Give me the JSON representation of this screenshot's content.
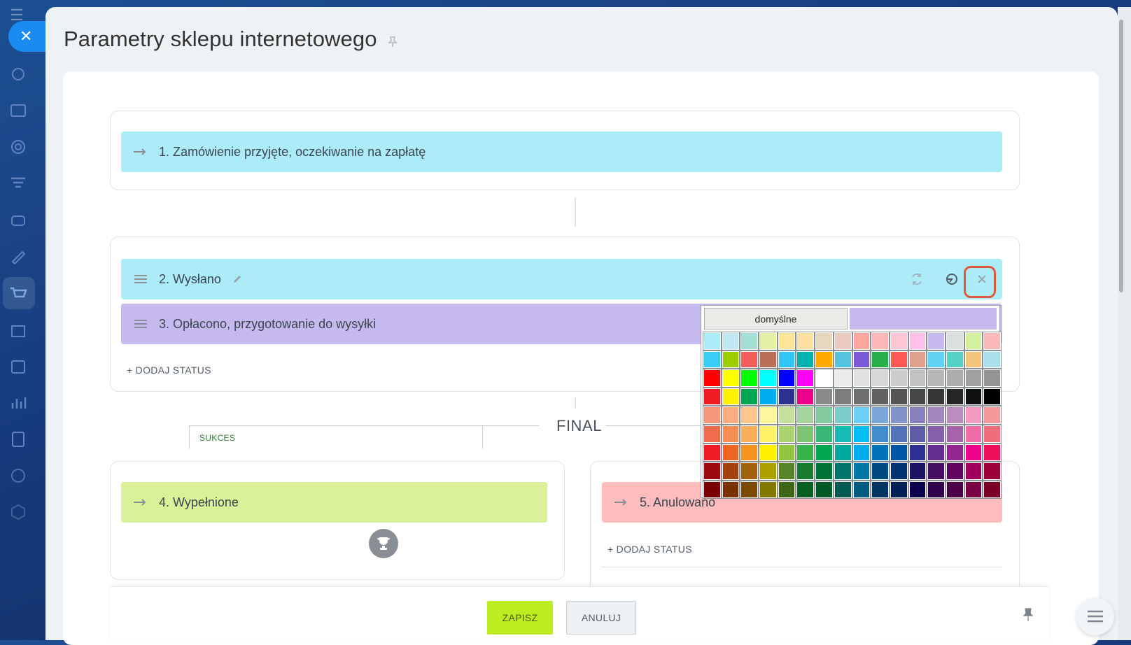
{
  "header": {
    "title": "Parametry sklepu internetowego",
    "pin_icon": "pin-icon"
  },
  "sidebar": {
    "items": [
      {
        "icon": "crm-icon"
      },
      {
        "icon": "contacts-icon"
      },
      {
        "icon": "target-icon"
      },
      {
        "icon": "funnel-icon"
      },
      {
        "icon": "robot-icon"
      },
      {
        "icon": "sign-icon"
      },
      {
        "icon": "cart-icon",
        "active": true
      },
      {
        "icon": "store-icon"
      },
      {
        "icon": "calendar-icon"
      },
      {
        "icon": "analytics-icon"
      },
      {
        "icon": "document-icon"
      },
      {
        "icon": "circle-icon"
      },
      {
        "icon": "box-icon"
      }
    ]
  },
  "statuses": {
    "s1": {
      "label": "1. Zamówienie przyjęte, oczekiwanie na zapłatę",
      "color": "#acebf8"
    },
    "s2": {
      "label": "2. Wysłano",
      "color": "#acebf8"
    },
    "s3": {
      "label": "3. Opłacono, przygotowanie do wysyłki",
      "color": "#c6b9ee"
    },
    "s4": {
      "label": "4. Wypełnione",
      "color": "#dbf199"
    },
    "s5": {
      "label": "5. Anulowano",
      "color": "#ffbebd"
    }
  },
  "add_status_label": "+ DODAJ STATUS",
  "final": {
    "label": "FINAL",
    "success_tab": "SUKCES"
  },
  "footer": {
    "save_label": "ZAPISZ",
    "cancel_label": "ANULUJ"
  },
  "picker": {
    "default_label": "domyślne",
    "colors": [
      "#acebf8",
      "#bfe8f2",
      "#a6dfd8",
      "#e4f0a4",
      "#fde598",
      "#fde1a0",
      "#e9d7bd",
      "#e9c9c0",
      "#fda69e",
      "#fbb8b6",
      "#ffc6d5",
      "#ffc0e8",
      "#c6b9ee",
      "#dcdfe0",
      "#d5f09c",
      "#fbb8b8",
      "#39cdf6",
      "#9dcf00",
      "#f45e5a",
      "#b96e56",
      "#2fc6f6",
      "#00b4ae",
      "#ffa900",
      "#55c3df",
      "#7b59d6",
      "#28b04a",
      "#ff5752",
      "#e0a08e",
      "#61d4f5",
      "#56d2c4",
      "#f4c47c",
      "#a9e0ec",
      "#ff0000",
      "#ffff00",
      "#00ff00",
      "#00ffff",
      "#0000ff",
      "#ff00ff",
      "#ffffff",
      "#ebebeb",
      "#e1e1e1",
      "#d7d7d7",
      "#cccccc",
      "#c2c2c2",
      "#b7b7b7",
      "#acacac",
      "#a0a0a0",
      "#959595",
      "#ee1d24",
      "#fff100",
      "#00a650",
      "#00aeef",
      "#2f3192",
      "#ed008c",
      "#898989",
      "#7d7d7d",
      "#707070",
      "#626262",
      "#555555",
      "#464646",
      "#363636",
      "#262626",
      "#111111",
      "#000000",
      "#f7977a",
      "#fbad82",
      "#fdc68c",
      "#fff799",
      "#c6df9c",
      "#a4d49d",
      "#81ca9d",
      "#7bcdc9",
      "#6ccff7",
      "#7ca6d8",
      "#8293ca",
      "#8881be",
      "#a286bd",
      "#bc8cbf",
      "#f49bc1",
      "#f5999d",
      "#f16c4d",
      "#f68e54",
      "#fbaf5a",
      "#fff467",
      "#acd372",
      "#7dc473",
      "#39b778",
      "#16bcb4",
      "#00bff3",
      "#438ccb",
      "#5573b7",
      "#5e5ca7",
      "#855fa8",
      "#a763a9",
      "#ef6ea8",
      "#f16d7e",
      "#ee1d24",
      "#f16522",
      "#f7941d",
      "#fff100",
      "#8fc63d",
      "#37b44a",
      "#00a650",
      "#00a99e",
      "#00aeef",
      "#0072bc",
      "#0054a5",
      "#2f3192",
      "#652c91",
      "#91278f",
      "#ed008c",
      "#ee105a",
      "#9d0a0f",
      "#a1410d",
      "#a36209",
      "#aba000",
      "#588528",
      "#197b30",
      "#007236",
      "#00736a",
      "#0076a4",
      "#004a80",
      "#003370",
      "#1d1363",
      "#450e61",
      "#62055f",
      "#9e005c",
      "#9d0039",
      "#790000",
      "#7b3000",
      "#7c4900",
      "#827a00",
      "#3e6617",
      "#045f20",
      "#005824",
      "#005951",
      "#005b7e",
      "#003562",
      "#002056",
      "#0c004b",
      "#30004a",
      "#4b0048",
      "#7a0045",
      "#7a0026"
    ]
  },
  "actions": {
    "refresh_icon": "refresh-icon",
    "palette_icon": "palette-icon",
    "close_icon": "close-icon"
  }
}
